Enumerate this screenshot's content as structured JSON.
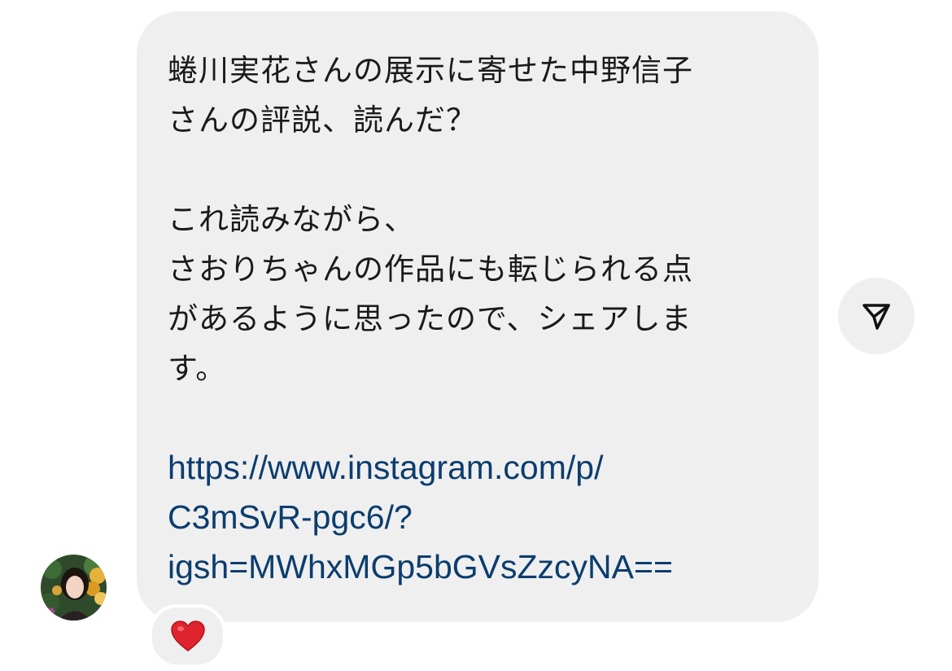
{
  "message": {
    "lines": [
      "蜷川実花さんの展示に寄せた中野信子",
      "さんの評説、読んだ？",
      "",
      "これ読みながら、",
      "さおりちゃんの作品にも転じられる点",
      "があるように思ったので、シェアしま",
      "す。",
      ""
    ],
    "link_lines": [
      "https://www.instagram.com/p/",
      "C3mSvR-pgc6/?",
      "igsh=MWhxMGp5bGVsZzcyNA=="
    ]
  },
  "reaction": {
    "emoji": "❤️"
  },
  "icons": {
    "share": "paper-plane-icon",
    "avatar": "profile-photo",
    "reaction": "heart-icon"
  },
  "colors": {
    "bubble_bg": "#efefef",
    "link": "#0b3d6e",
    "text": "#1a1a1a",
    "heart": "#e0242e"
  }
}
